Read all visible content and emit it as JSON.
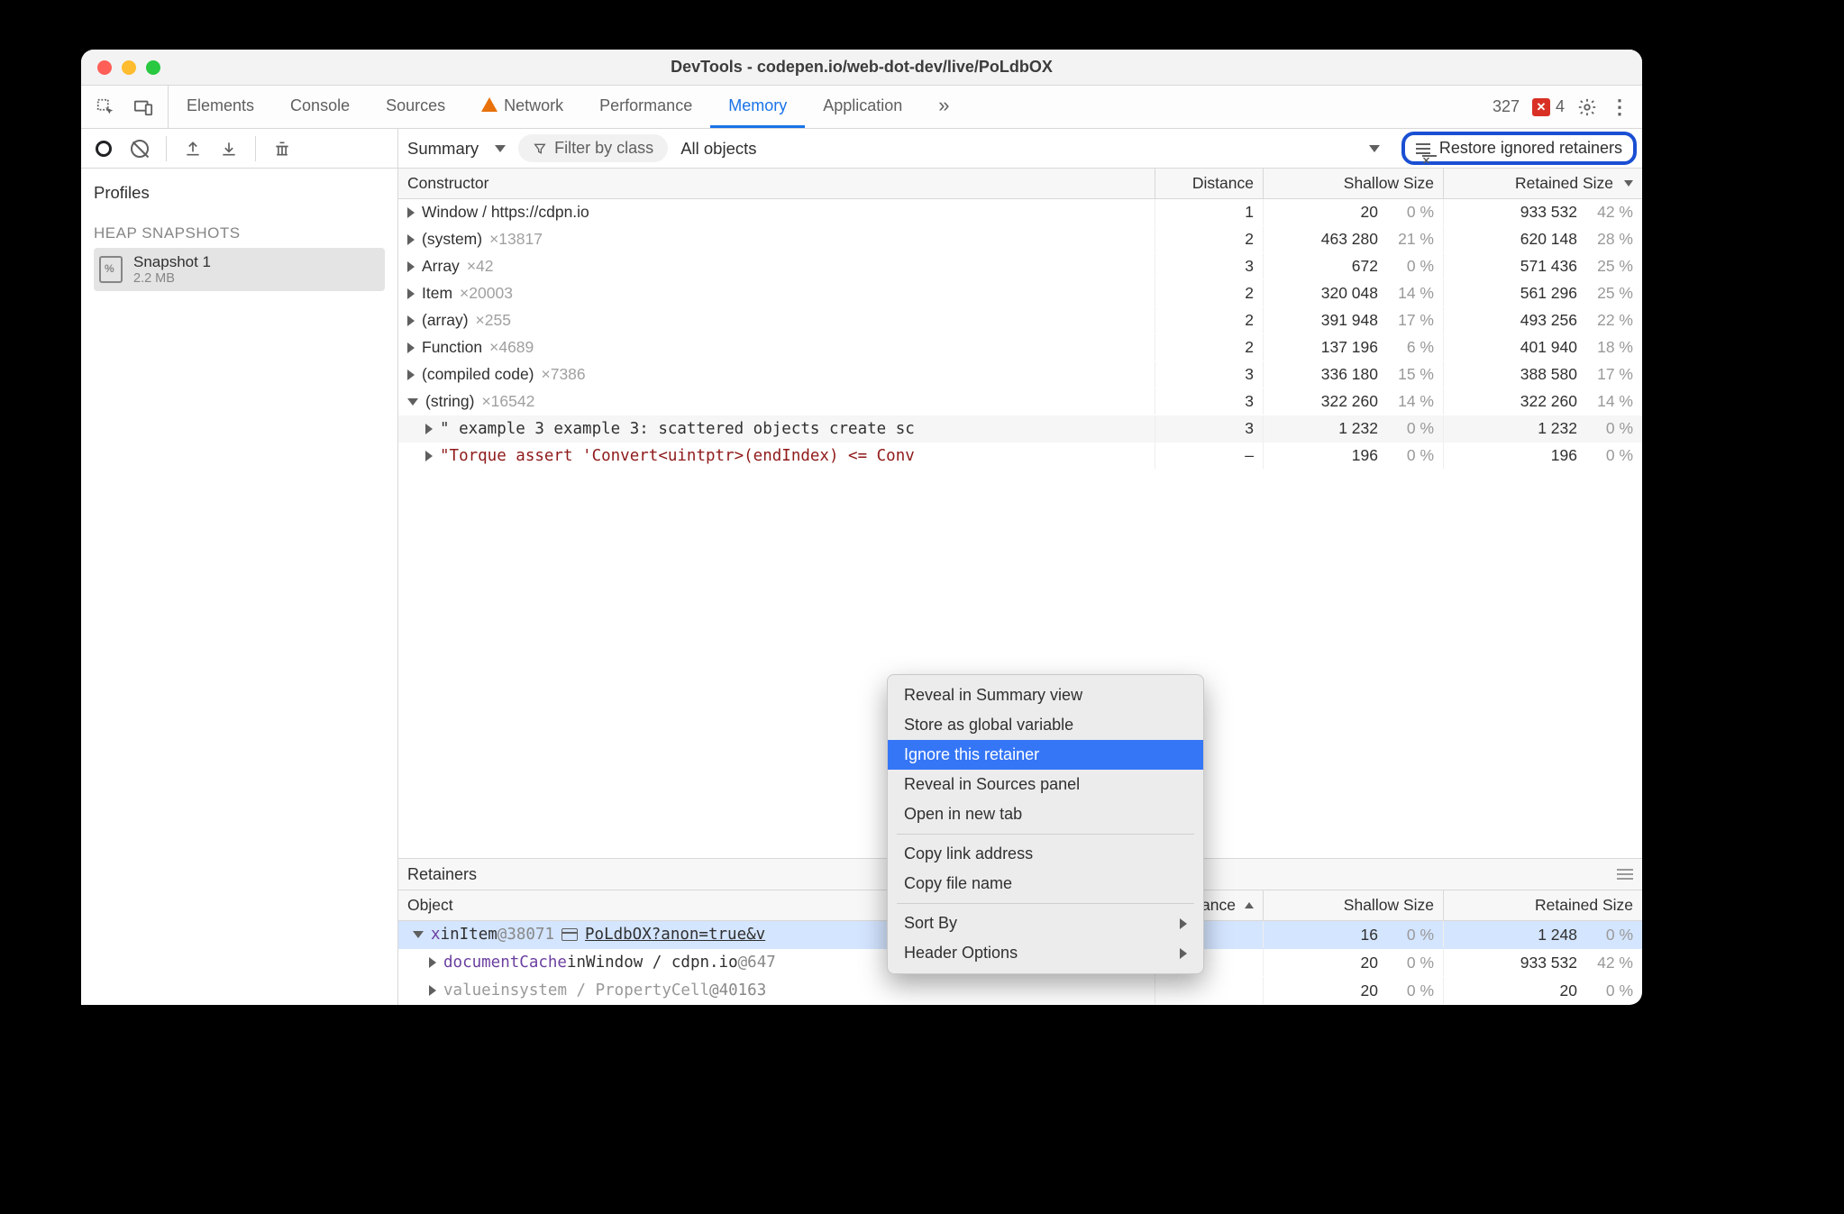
{
  "titlebar": {
    "title": "DevTools - codepen.io/web-dot-dev/live/PoLdbOX"
  },
  "tabs": {
    "items": [
      "Elements",
      "Console",
      "Sources",
      "Network",
      "Performance",
      "Memory",
      "Application"
    ],
    "active": "Memory",
    "warn_tab": "Network"
  },
  "tabbar_right": {
    "warn_count": "327",
    "err_symbol": "✕",
    "err_count": "4"
  },
  "sidebar": {
    "profiles_label": "Profiles",
    "heap_label": "HEAP SNAPSHOTS",
    "snapshot": {
      "name": "Snapshot 1",
      "size": "2.2 MB"
    }
  },
  "toolbar": {
    "summary_label": "Summary",
    "filter_label": "Filter by class",
    "all_objects_label": "All objects",
    "restore_label": "Restore ignored retainers"
  },
  "header": {
    "constructor": "Constructor",
    "distance": "Distance",
    "shallow": "Shallow Size",
    "retained": "Retained Size"
  },
  "rows": [
    {
      "name": "Window / https://cdpn.io",
      "count": "",
      "dist": "1",
      "sh": "20",
      "shp": "0 %",
      "ret": "933 532",
      "retp": "42 %",
      "open": false
    },
    {
      "name": "(system)",
      "count": "×13817",
      "dist": "2",
      "sh": "463 280",
      "shp": "21 %",
      "ret": "620 148",
      "retp": "28 %",
      "open": false
    },
    {
      "name": "Array",
      "count": "×42",
      "dist": "3",
      "sh": "672",
      "shp": "0 %",
      "ret": "571 436",
      "retp": "25 %",
      "open": false
    },
    {
      "name": "Item",
      "count": "×20003",
      "dist": "2",
      "sh": "320 048",
      "shp": "14 %",
      "ret": "561 296",
      "retp": "25 %",
      "open": false
    },
    {
      "name": "(array)",
      "count": "×255",
      "dist": "2",
      "sh": "391 948",
      "shp": "17 %",
      "ret": "493 256",
      "retp": "22 %",
      "open": false
    },
    {
      "name": "Function",
      "count": "×4689",
      "dist": "2",
      "sh": "137 196",
      "shp": "6 %",
      "ret": "401 940",
      "retp": "18 %",
      "open": false
    },
    {
      "name": "(compiled code)",
      "count": "×7386",
      "dist": "3",
      "sh": "336 180",
      "shp": "15 %",
      "ret": "388 580",
      "retp": "17 %",
      "open": false
    },
    {
      "name": "(string)",
      "count": "×16542",
      "dist": "3",
      "sh": "322 260",
      "shp": "14 %",
      "ret": "322 260",
      "retp": "14 %",
      "open": true
    }
  ],
  "string_children": [
    {
      "text": "\" example 3 example 3: scattered objects create sc",
      "dist": "3",
      "sh": "1 232",
      "shp": "0 %",
      "ret": "1 232",
      "retp": "0 %",
      "alt": true
    },
    {
      "text": "\"Torque assert 'Convert<uintptr>(endIndex) <= Conv",
      "dist": "–",
      "sh": "196",
      "shp": "0 %",
      "ret": "196",
      "retp": "0 %",
      "alt": false,
      "red": true
    }
  ],
  "retainers_title": "Retainers",
  "retainer_header": {
    "object": "Object",
    "distance": "Distance",
    "shallow": "Shallow Size",
    "retained": "Retained Size"
  },
  "retainer_rows": [
    {
      "prefix": "x",
      "mid": " in ",
      "obj": "Item ",
      "id": "@38071",
      "link": "PoLdbOX?anon=true&v",
      "dist": "",
      "sh": "16",
      "shp": "0 %",
      "ret": "1 248",
      "retp": "0 %",
      "open": true,
      "sel": true,
      "showwin": true
    },
    {
      "prefix": "documentCache",
      "mid": " in ",
      "obj": "Window / cdpn.io ",
      "id": "@647",
      "dist": "",
      "sh": "20",
      "shp": "0 %",
      "ret": "933 532",
      "retp": "42 %",
      "open": false,
      "indent": true
    },
    {
      "prefix": "value",
      "mid": " in ",
      "obj": "system / PropertyCell ",
      "id": "@40163",
      "dist": "",
      "sh": "20",
      "shp": "0 %",
      "ret": "20",
      "retp": "0 %",
      "open": false,
      "indent": true,
      "gray": true
    }
  ],
  "context_menu": {
    "items": [
      "Reveal in Summary view",
      "Store as global variable",
      "Ignore this retainer",
      "Reveal in Sources panel",
      "Open in new tab"
    ],
    "items2": [
      "Copy link address",
      "Copy file name"
    ],
    "items3": [
      "Sort By",
      "Header Options"
    ],
    "highlighted": 2
  }
}
